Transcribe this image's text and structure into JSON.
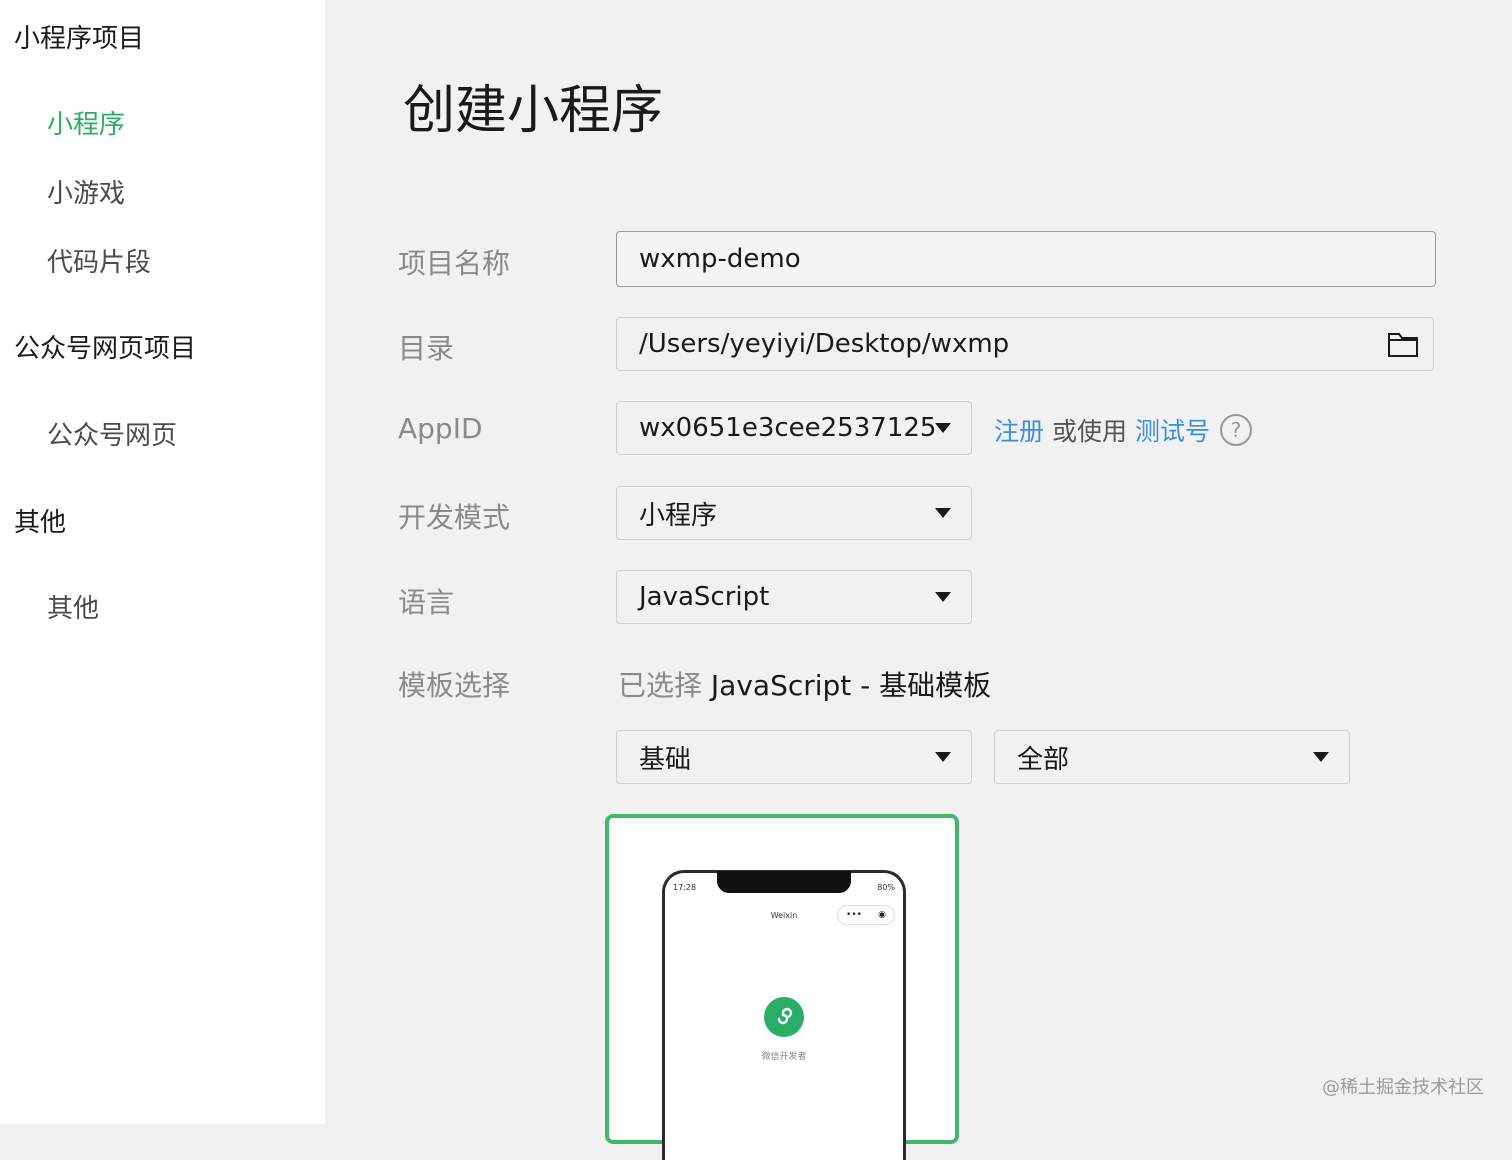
{
  "sidebar": {
    "groups": [
      {
        "title": "小程序项目",
        "items": [
          "小程序",
          "小游戏",
          "代码片段"
        ]
      },
      {
        "title": "公众号网页项目",
        "items": [
          "公众号网页"
        ]
      },
      {
        "title": "其他",
        "items": [
          "其他"
        ]
      }
    ],
    "active_item": "小程序"
  },
  "main": {
    "title": "创建小程序",
    "fields": {
      "project_name": {
        "label": "项目名称",
        "value": "wxmp-demo"
      },
      "directory": {
        "label": "目录",
        "value": "/Users/yeyiyi/Desktop/wxmp",
        "icon": "folder-icon"
      },
      "appid": {
        "label": "AppID",
        "value": "wx0651e3cee2537125",
        "register_link": "注册",
        "or_use": "或使用",
        "test_link": "测试号",
        "help": "?"
      },
      "dev_mode": {
        "label": "开发模式",
        "value": "小程序"
      },
      "language": {
        "label": "语言",
        "value": "JavaScript"
      },
      "template": {
        "label": "模板选择",
        "prefix": "已选择",
        "selected": "JavaScript - 基础模板",
        "filter_category": "基础",
        "filter_scope": "全部"
      }
    },
    "template_card": {
      "time": "17:28",
      "battery": "80%",
      "nav_title": "Weixin",
      "caption": "微信开发者"
    }
  },
  "watermark": "@稀土掘金技术社区",
  "colors": {
    "accent_green": "#2aae67",
    "card_border": "#43b86b",
    "link_blue": "#3c8fe0"
  }
}
